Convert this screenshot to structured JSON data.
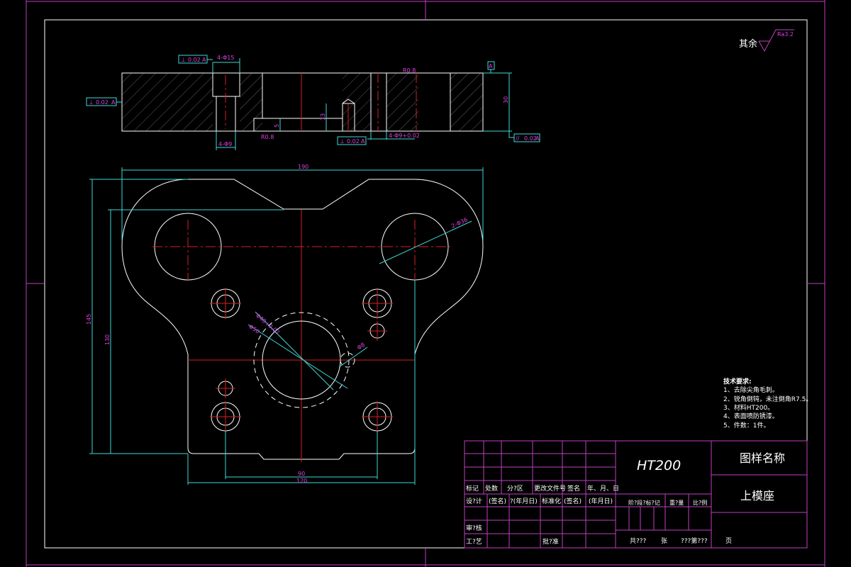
{
  "surface_finish": {
    "label": "其余",
    "roughness": "Ra3.2"
  },
  "section_view": {
    "tol_left": {
      "symbol": "⊥",
      "value": "0.02",
      "datum": "A"
    },
    "tol_top": {
      "symbol": "⊥",
      "value": "0.02",
      "datum": "A"
    },
    "tol_bottom": {
      "symbol": "⊥",
      "value": "0.02",
      "datum": "A"
    },
    "tol_right": {
      "symbol": "//",
      "value": "0.02",
      "datum": "A"
    },
    "datum_label": "A",
    "dim_counterbore": "4-Φ15",
    "dim_hole": "4-Φ9",
    "dim_pin": "4-Φ9+0.02",
    "dim_height": "30",
    "dim_step": "5",
    "dim_depth": "13",
    "roughness_1": "R0.8",
    "roughness_2": "R0.8"
  },
  "plan_view": {
    "dim_width": "190",
    "dim_height_outer": "145",
    "dim_height_inner": "130",
    "dim_hole_spacing": "90",
    "dim_plate_width": "120",
    "dim_guide_holes": "2-Φ36",
    "dim_bore": "Φ40+0.02",
    "dim_counterbore": "Φ50",
    "dim_small_hole": "Φ8"
  },
  "tech_requirements": {
    "title": "技术要求:",
    "items": [
      "1、去除尖角毛刺。",
      "2、锐角倒钝，未注倒角R7.5。",
      "3、材料HT200。",
      "4、表面喷防锈漆。",
      "5、件数：1件。"
    ]
  },
  "title_block": {
    "material": "HT200",
    "drawing_name_label": "图样名称",
    "part_name": "上模座",
    "header_row": [
      "标记",
      "处数",
      "分?区",
      "更改文件号",
      "签名",
      "年、月、日"
    ],
    "design_row": [
      "设?计",
      "(签名)",
      "?(年月日)",
      "标准化",
      "(签名)",
      "(年月日)"
    ],
    "review_label": "审?核",
    "process_label": "工?艺",
    "approve_label": "批?准",
    "stage_label": "阶?段?标?记",
    "weight_label": "重?量",
    "scale_label": "比?例",
    "sheet_total": "共???",
    "sheet_unit": "张",
    "sheet_no": "???第???",
    "page_unit": "页"
  },
  "colors": {
    "frame": "#c040c0",
    "geometry": "#ffffff",
    "centerline": "#d62020",
    "dimension": "#3fd8d8",
    "dim_text": "#e040e0"
  }
}
